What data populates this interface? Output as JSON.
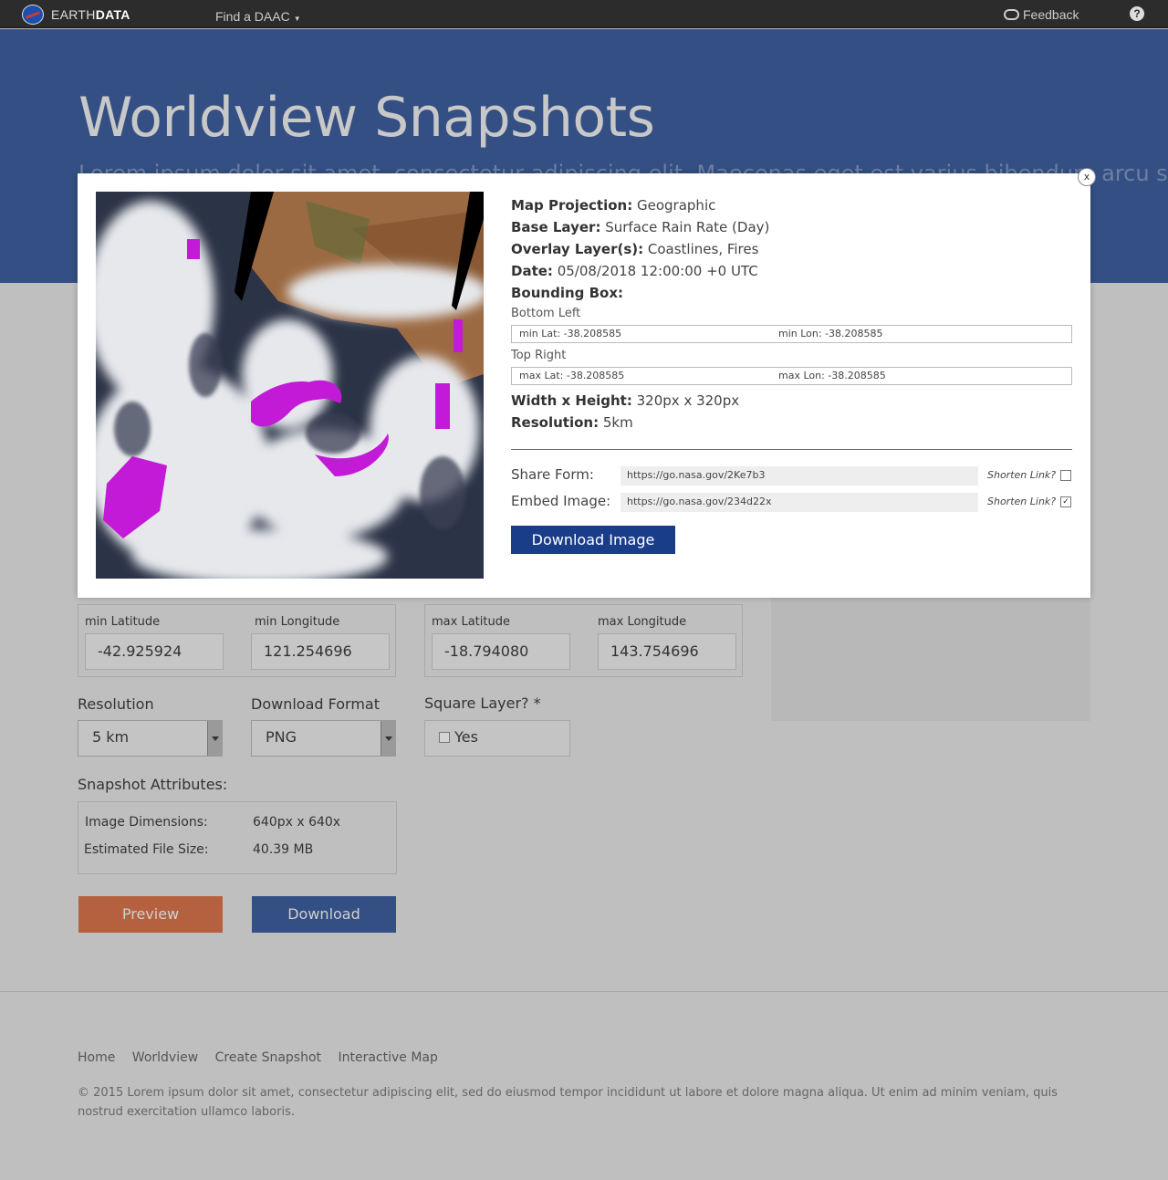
{
  "nav": {
    "brand_prefix": "EARTH",
    "brand_suffix": "DATA",
    "find_daac": "Find a DAAC",
    "feedback": "Feedback",
    "help": "?"
  },
  "hero": {
    "title": "Worldview Snapshots",
    "subtitle": "Lorem ipsum dolor sit amet, consectetur adipiscing elit. Maecenas eget est varius bibendum arcu semper"
  },
  "form": {
    "min_lat_label": "min Latitude",
    "min_lat": "-42.925924",
    "min_lon_label": "min Longitude",
    "min_lon": "121.254696",
    "max_lat_label": "max Latitude",
    "max_lat": "-18.794080",
    "max_lon_label": "max Longitude",
    "max_lon": "143.754696",
    "resolution_label": "Resolution",
    "resolution": "5 km",
    "format_label": "Download Format",
    "format": "PNG",
    "square_label": "Square Layer?",
    "square_mark": "*",
    "square_option": "Yes",
    "attributes_label": "Snapshot Attributes:",
    "dims_label": "Image Dimensions:",
    "dims": "640px x 640x",
    "size_label": "Estimated File Size:",
    "size": "40.39 MB",
    "preview": "Preview",
    "download": "Download"
  },
  "footer": {
    "links": [
      "Home",
      "Worldview",
      "Create Snapshot",
      "Interactive Map"
    ],
    "copyright": "© 2015 Lorem ipsum dolor sit amet, consectetur adipiscing elit, sed do eiusmod tempor incididunt ut labore et dolore magna aliqua. Ut enim ad minim veniam, quis nostrud exercitation ullamco laboris."
  },
  "modal": {
    "close": "x",
    "projection_label": "Map Projection:",
    "projection": "Geographic",
    "base_label": "Base Layer:",
    "base": "Surface Rain Rate (Day)",
    "overlay_label": "Overlay Layer(s):",
    "overlay": "Coastlines, Fires",
    "date_label": "Date:",
    "date": "05/08/2018 12:00:00 +0 UTC",
    "bbox_label": "Bounding Box:",
    "bottom_left": "Bottom Left",
    "bl_lat": "min Lat: -38.208585",
    "bl_lon": "min Lon: -38.208585",
    "top_right": "Top Right",
    "tr_lat": "max Lat: -38.208585",
    "tr_lon": "max Lon: -38.208585",
    "wh_label": "Width x Height:",
    "wh": "320px x 320px",
    "res_label": "Resolution:",
    "res": "5km",
    "share_label": "Share Form:",
    "share_url": "https://go.nasa.gov/2Ke7b3",
    "embed_label": "Embed Image:",
    "embed_url": "https://go.nasa.gov/234d22x",
    "shorten": "Shorten Link?",
    "share_shorten_checked": false,
    "embed_shorten_checked": true,
    "download_image": "Download Image"
  }
}
